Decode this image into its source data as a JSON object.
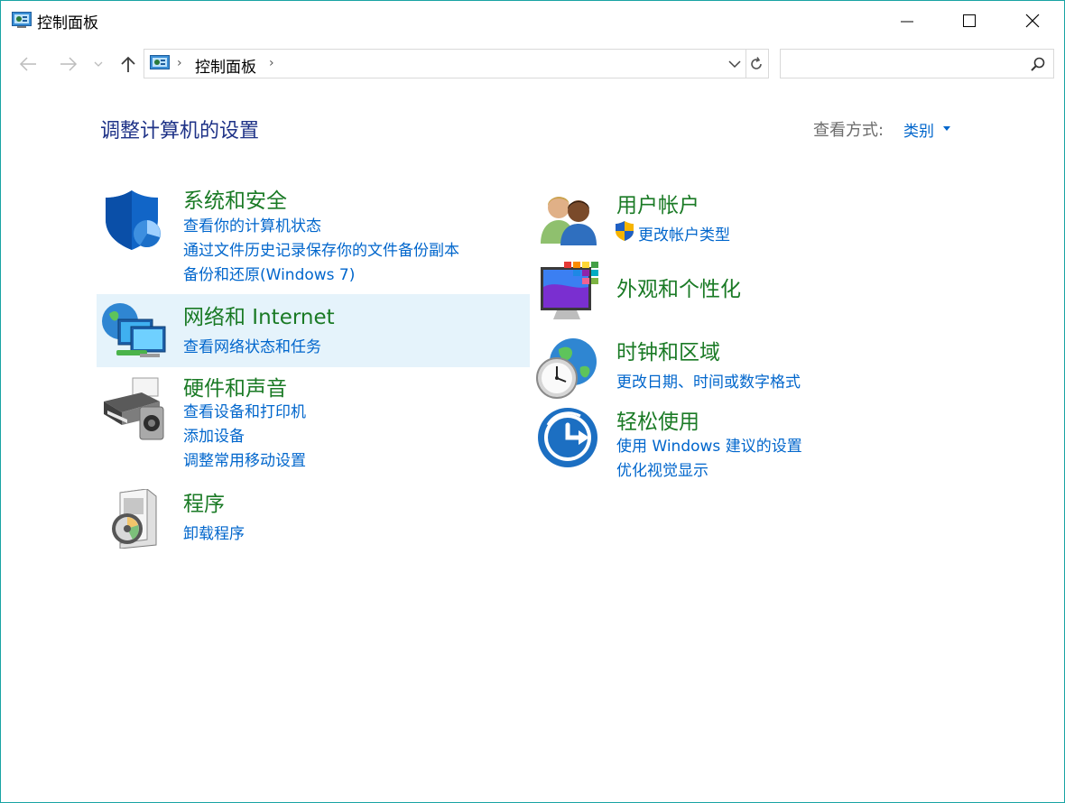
{
  "window": {
    "title": "控制面板"
  },
  "address_bar": {
    "path": "控制面板",
    "search_placeholder": ""
  },
  "header": {
    "title": "调整计算机的设置",
    "view_by_label": "查看方式:",
    "view_by_value": "类别"
  },
  "categories": {
    "system_security": {
      "title": "系统和安全",
      "links": [
        "查看你的计算机状态",
        "通过文件历史记录保存你的文件备份副本",
        "备份和还原(Windows 7)"
      ]
    },
    "network": {
      "title": "网络和 Internet",
      "links": [
        "查看网络状态和任务"
      ]
    },
    "hardware": {
      "title": "硬件和声音",
      "links": [
        "查看设备和打印机",
        "添加设备",
        "调整常用移动设置"
      ]
    },
    "programs": {
      "title": "程序",
      "links": [
        "卸载程序"
      ]
    },
    "user_accounts": {
      "title": "用户帐户",
      "links": [
        "更改帐户类型"
      ]
    },
    "appearance": {
      "title": "外观和个性化",
      "links": []
    },
    "clock_region": {
      "title": "时钟和区域",
      "links": [
        "更改日期、时间或数字格式"
      ]
    },
    "ease_of_access": {
      "title": "轻松使用",
      "links": [
        "使用 Windows 建议的设置",
        "优化视觉显示"
      ]
    }
  }
}
